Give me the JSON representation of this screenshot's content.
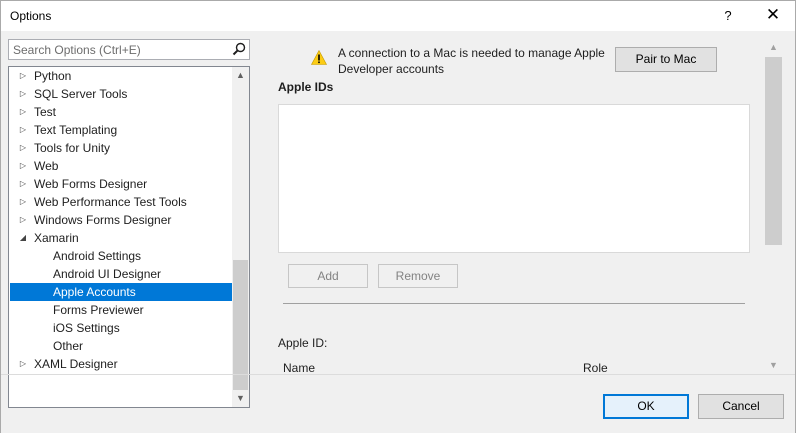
{
  "window": {
    "title": "Options",
    "help_label": "?",
    "close_label": "✕"
  },
  "search": {
    "placeholder": "Search Options (Ctrl+E)",
    "icon": "search-icon"
  },
  "tree": {
    "items": [
      {
        "label": "Python",
        "level": 0,
        "expander": "collapsed"
      },
      {
        "label": "SQL Server Tools",
        "level": 0,
        "expander": "collapsed"
      },
      {
        "label": "Test",
        "level": 0,
        "expander": "collapsed"
      },
      {
        "label": "Text Templating",
        "level": 0,
        "expander": "collapsed"
      },
      {
        "label": "Tools for Unity",
        "level": 0,
        "expander": "collapsed"
      },
      {
        "label": "Web",
        "level": 0,
        "expander": "collapsed"
      },
      {
        "label": "Web Forms Designer",
        "level": 0,
        "expander": "collapsed"
      },
      {
        "label": "Web Performance Test Tools",
        "level": 0,
        "expander": "collapsed"
      },
      {
        "label": "Windows Forms Designer",
        "level": 0,
        "expander": "collapsed"
      },
      {
        "label": "Xamarin",
        "level": 0,
        "expander": "expanded"
      },
      {
        "label": "Android Settings",
        "level": 1,
        "expander": "none"
      },
      {
        "label": "Android UI Designer",
        "level": 1,
        "expander": "none"
      },
      {
        "label": "Apple Accounts",
        "level": 1,
        "expander": "none",
        "selected": true
      },
      {
        "label": "Forms Previewer",
        "level": 1,
        "expander": "none"
      },
      {
        "label": "iOS Settings",
        "level": 1,
        "expander": "none"
      },
      {
        "label": "Other",
        "level": 1,
        "expander": "none"
      },
      {
        "label": "XAML Designer",
        "level": 0,
        "expander": "collapsed"
      }
    ]
  },
  "panel": {
    "warning_text": "A connection to a Mac is needed to manage Apple Developer accounts",
    "pair_button": "Pair to Mac",
    "apple_ids_title": "Apple IDs",
    "add_button": "Add",
    "remove_button": "Remove",
    "apple_id_label": "Apple ID:",
    "columns": [
      "Name",
      "Role"
    ]
  },
  "footer": {
    "ok_label": "OK",
    "cancel_label": "Cancel"
  },
  "colors": {
    "selection": "#0078d7",
    "warning": "#fccc14",
    "dialog_bg": "#f0f0f0"
  }
}
